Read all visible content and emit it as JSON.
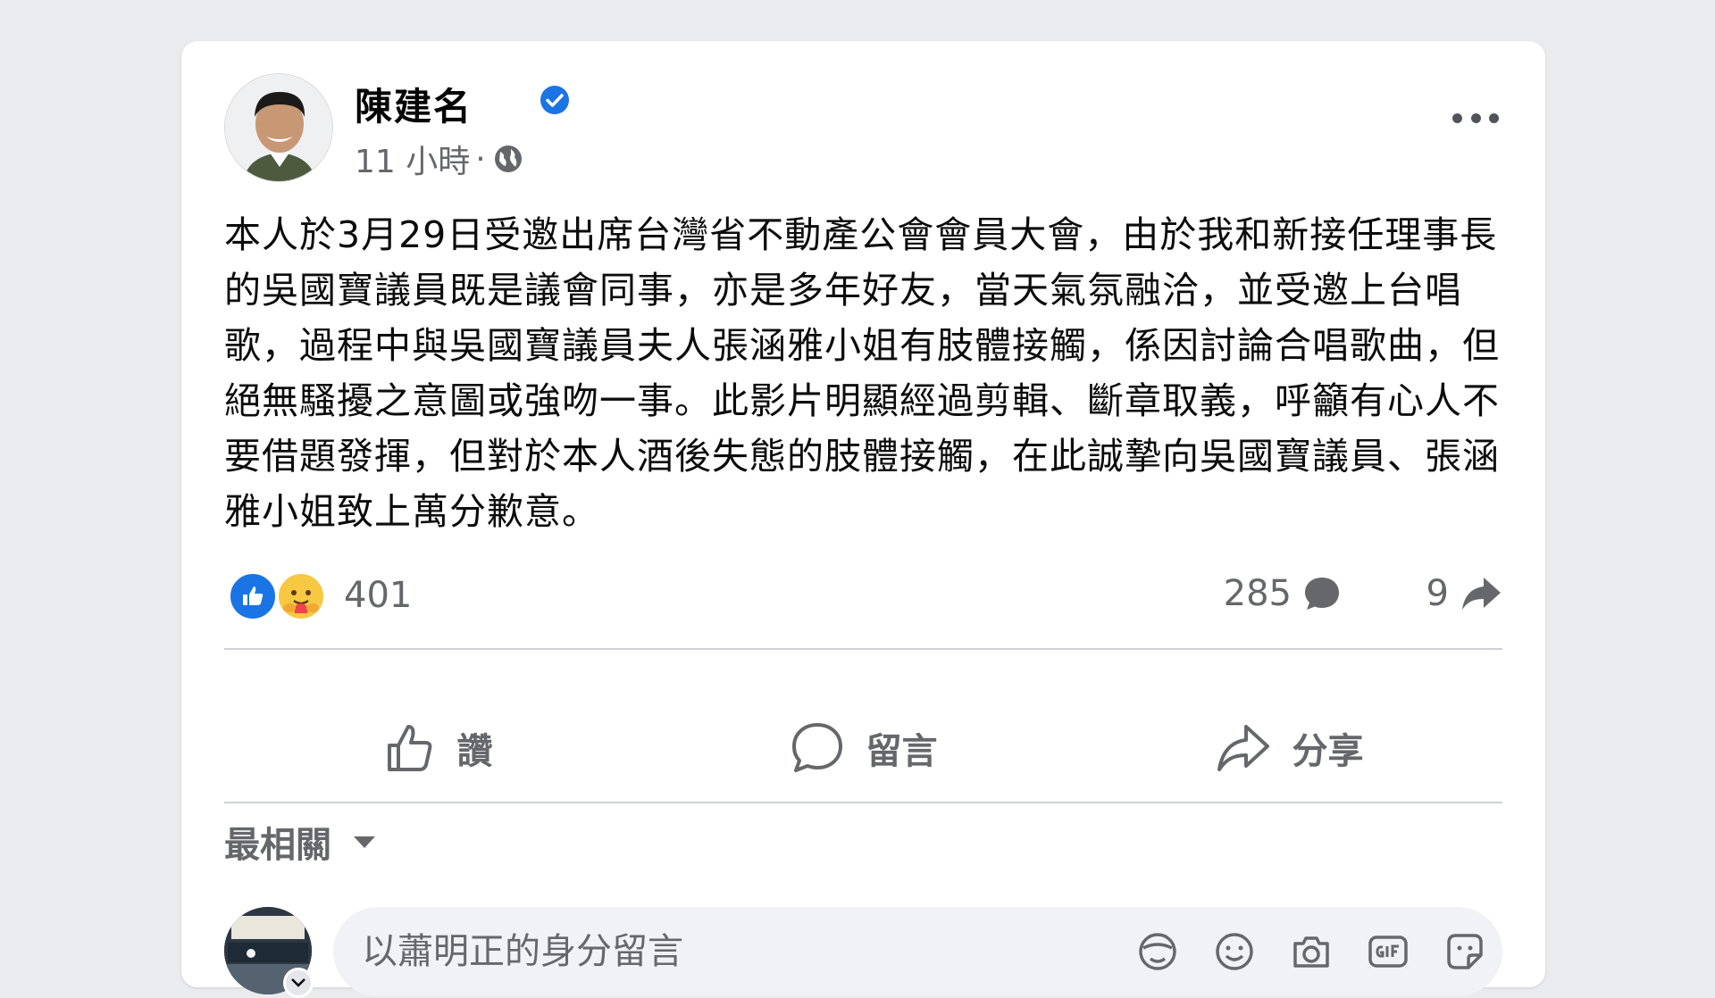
{
  "post": {
    "author": "陳建名",
    "time": "11 小時",
    "meta_separator": "·",
    "text": "本人於3月29日受邀出席台灣省不動產公會會員大會，由於我和新接任理事長的吳國寶議員既是議會同事，亦是多年好友，當天氣氛融洽，並受邀上台唱歌，過程中與吳國寶議員夫人張涵雅小姐有肢體接觸，係因討論合唱歌曲，但絕無騷擾之意圖或強吻一事。此影片明顯經過剪輯、斷章取義，呼籲有心人不要借題發揮，但對於本人酒後失態的肢體接觸，在此誠摯向吳國寶議員、張涵雅小姐致上萬分歉意。"
  },
  "stats": {
    "reactions": "401",
    "comments": "285",
    "shares": "9"
  },
  "actions": {
    "like": "讚",
    "comment": "留言",
    "share": "分享"
  },
  "comments_section": {
    "sort_label": "最相關",
    "input_placeholder": "以蕭明正的身分留言"
  },
  "colors": {
    "accent": "#1b74e4",
    "secondary_text": "#65676b",
    "background": "#e9ebee"
  },
  "icons": [
    "verified-badge-icon",
    "globe-icon",
    "more-options-icon",
    "like-reaction-icon",
    "care-reaction-icon",
    "comment-bubble-icon",
    "share-arrow-icon",
    "thumbs-up-icon",
    "comment-icon",
    "share-icon",
    "caret-down-icon",
    "avatar-sticker-icon",
    "emoji-icon",
    "camera-icon",
    "gif-icon",
    "sticker-icon"
  ]
}
